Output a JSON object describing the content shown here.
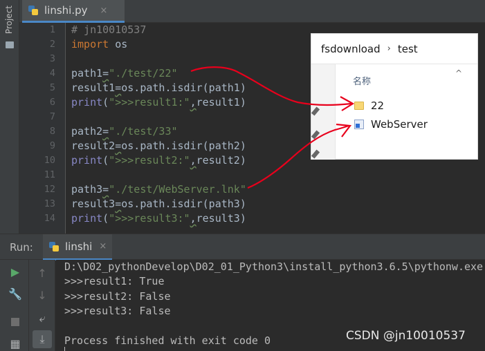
{
  "side_panel": {
    "label": "Project"
  },
  "editor_tab": {
    "filename": "linshi.py",
    "close_glyph": "×"
  },
  "code_lines": [
    {
      "n": "1",
      "parts": [
        {
          "t": "# jn10010537",
          "c": "cmt"
        }
      ]
    },
    {
      "n": "2",
      "parts": [
        {
          "t": "import",
          "c": "kw"
        },
        {
          "t": " os",
          "c": ""
        }
      ]
    },
    {
      "n": "3",
      "parts": []
    },
    {
      "n": "4",
      "parts": [
        {
          "t": "path1",
          "c": ""
        },
        {
          "t": "=",
          "c": "op"
        },
        {
          "t": "\"./test/22\"",
          "c": "str"
        }
      ]
    },
    {
      "n": "5",
      "parts": [
        {
          "t": "result1",
          "c": ""
        },
        {
          "t": "=",
          "c": "op"
        },
        {
          "t": "os.path.isdir(path1)",
          "c": ""
        }
      ]
    },
    {
      "n": "6",
      "parts": [
        {
          "t": "print",
          "c": "bi"
        },
        {
          "t": "(",
          "c": ""
        },
        {
          "t": "\">>>result1:\"",
          "c": "str"
        },
        {
          "t": ",",
          "c": "op"
        },
        {
          "t": "result1)",
          "c": ""
        }
      ]
    },
    {
      "n": "7",
      "parts": []
    },
    {
      "n": "8",
      "parts": [
        {
          "t": "path2",
          "c": ""
        },
        {
          "t": "=",
          "c": "op"
        },
        {
          "t": "\"./test/33\"",
          "c": "str"
        }
      ]
    },
    {
      "n": "9",
      "parts": [
        {
          "t": "result2",
          "c": ""
        },
        {
          "t": "=",
          "c": "op"
        },
        {
          "t": "os.path.isdir(path2)",
          "c": ""
        }
      ]
    },
    {
      "n": "10",
      "parts": [
        {
          "t": "print",
          "c": "bi"
        },
        {
          "t": "(",
          "c": ""
        },
        {
          "t": "\">>>result2:\"",
          "c": "str"
        },
        {
          "t": ",",
          "c": "op"
        },
        {
          "t": "result2)",
          "c": ""
        }
      ]
    },
    {
      "n": "11",
      "parts": []
    },
    {
      "n": "12",
      "parts": [
        {
          "t": "path3",
          "c": ""
        },
        {
          "t": "=",
          "c": "op"
        },
        {
          "t": "\"./test/WebServer.lnk\"",
          "c": "str"
        }
      ]
    },
    {
      "n": "13",
      "parts": [
        {
          "t": "result3",
          "c": ""
        },
        {
          "t": "=",
          "c": "op"
        },
        {
          "t": "os.path.isdir(path3)",
          "c": ""
        }
      ]
    },
    {
      "n": "14",
      "parts": [
        {
          "t": "print",
          "c": "bi"
        },
        {
          "t": "(",
          "c": ""
        },
        {
          "t": "\">>>result3:\"",
          "c": "str"
        },
        {
          "t": ",",
          "c": "op"
        },
        {
          "t": "result3)",
          "c": ""
        }
      ]
    }
  ],
  "explorer": {
    "breadcrumb": [
      "fsdownload",
      "test"
    ],
    "breadcrumb_sep": "›",
    "column_header": "名称",
    "collapse_glyph": "^",
    "items": [
      {
        "name": "22",
        "kind": "folder"
      },
      {
        "name": "WebServer",
        "kind": "shortcut"
      }
    ]
  },
  "annotation_color": "#e8001c",
  "run_panel": {
    "title": "Run:",
    "tab_label": "linshi",
    "close_glyph": "×",
    "console_lines": [
      "D:\\D02_pythonDevelop\\D02_01_Python3\\install_python3.6.5\\pythonw.exe",
      ">>>result1: True",
      ">>>result2: False",
      ">>>result3: False",
      "",
      "Process finished with exit code 0"
    ]
  },
  "toolbar_icons": [
    "run-icon",
    "wrench-icon",
    "stop-icon",
    "layout-icon",
    "up-arrow-icon",
    "down-arrow-icon",
    "soft-wrap-icon",
    "scroll-to-end-icon"
  ],
  "watermark": "CSDN @jn10010537"
}
